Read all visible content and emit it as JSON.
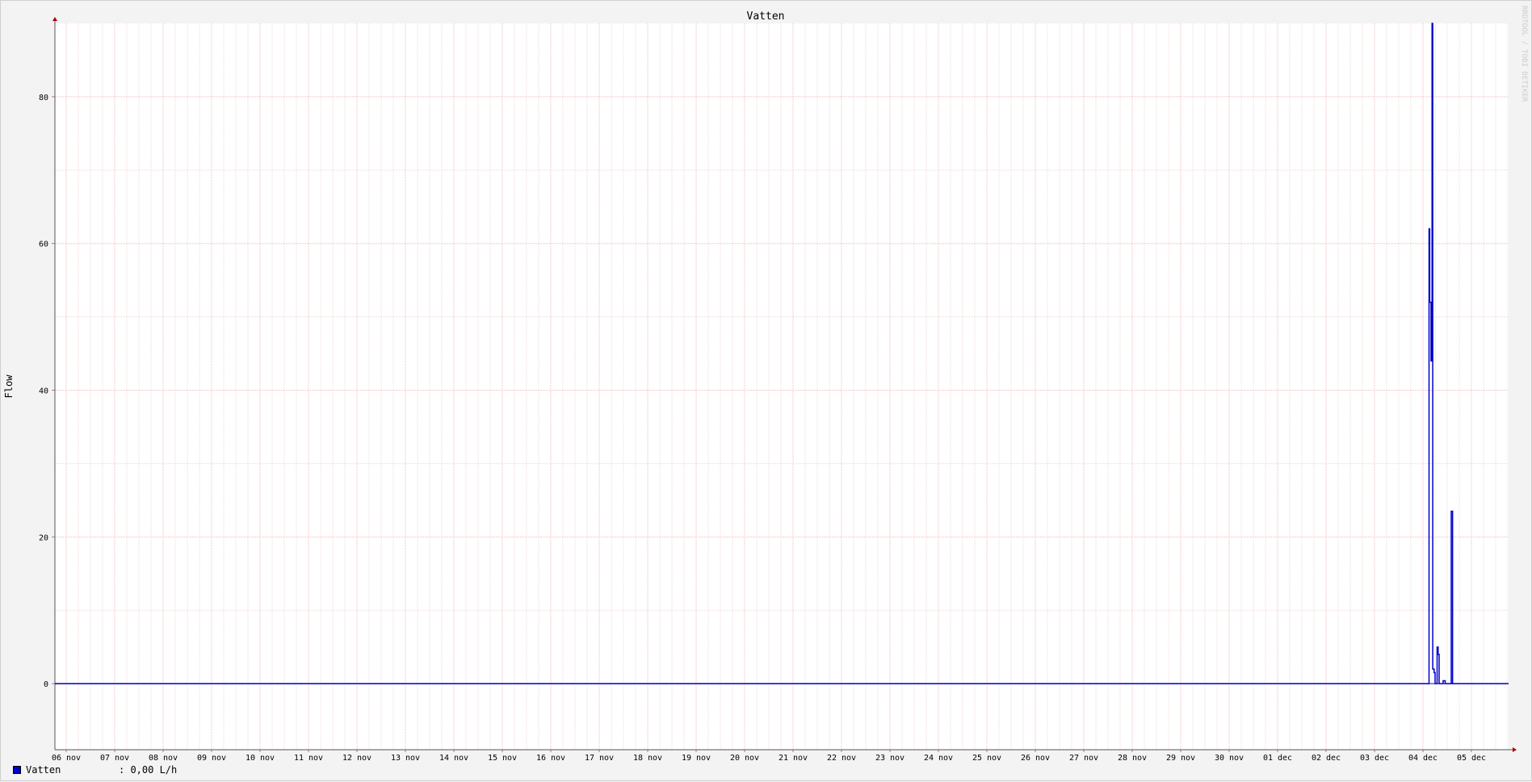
{
  "chart_data": {
    "type": "line",
    "title": "Vatten",
    "ylabel": "Flow",
    "xlabel": "",
    "ylim": [
      -9,
      90
    ],
    "yticks": [
      0,
      20,
      40,
      60,
      80
    ],
    "grid": true,
    "watermark": "RRDTOOL / TOBI OETIKER",
    "x_tick_labels": [
      "06 nov",
      "07 nov",
      "08 nov",
      "09 nov",
      "10 nov",
      "11 nov",
      "12 nov",
      "13 nov",
      "14 nov",
      "15 nov",
      "16 nov",
      "17 nov",
      "18 nov",
      "19 nov",
      "20 nov",
      "21 nov",
      "22 nov",
      "23 nov",
      "24 nov",
      "25 nov",
      "26 nov",
      "27 nov",
      "28 nov",
      "29 nov",
      "30 nov",
      "01 dec",
      "02 dec",
      "03 dec",
      "04 dec",
      "05 dec"
    ],
    "series": [
      {
        "name": "Vatten",
        "color": "#0000cc",
        "points": [
          {
            "x": "04 dec 02:00",
            "y": 0
          },
          {
            "x": "04 dec 03:00",
            "y": 62
          },
          {
            "x": "04 dec 03:20",
            "y": 52
          },
          {
            "x": "04 dec 04:00",
            "y": 44
          },
          {
            "x": "04 dec 04:30",
            "y": 90
          },
          {
            "x": "04 dec 04:50",
            "y": 2
          },
          {
            "x": "04 dec 05:30",
            "y": 1.5
          },
          {
            "x": "04 dec 06:00",
            "y": 0
          },
          {
            "x": "04 dec 07:00",
            "y": 5
          },
          {
            "x": "04 dec 07:30",
            "y": 4
          },
          {
            "x": "04 dec 08:00",
            "y": 0
          },
          {
            "x": "04 dec 10:00",
            "y": 0.4
          },
          {
            "x": "04 dec 11:00",
            "y": 0
          },
          {
            "x": "04 dec 14:00",
            "y": 23.5
          },
          {
            "x": "04 dec 14:40",
            "y": 0
          }
        ]
      }
    ]
  },
  "legend": {
    "name": "Vatten",
    "value_text": ": 0,00 L/h",
    "color": "#0000cc"
  }
}
